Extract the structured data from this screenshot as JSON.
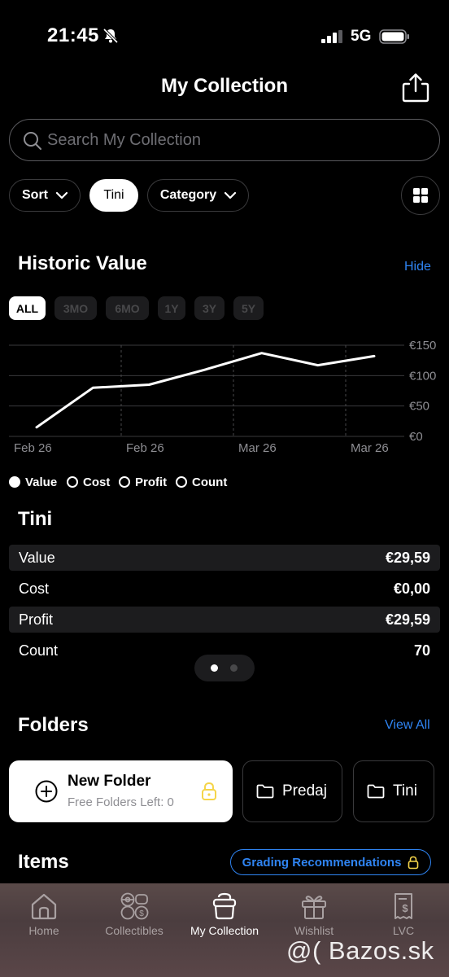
{
  "status_bar": {
    "time": "21:45",
    "network": "5G"
  },
  "header": {
    "title": "My Collection"
  },
  "search": {
    "placeholder": "Search My Collection"
  },
  "filters": {
    "sort_label": "Sort",
    "selected_chip": "Tini",
    "category_label": "Category"
  },
  "historic": {
    "title": "Historic Value",
    "hide_label": "Hide",
    "ranges": [
      "ALL",
      "3MO",
      "6MO",
      "1Y",
      "3Y",
      "5Y"
    ],
    "selected_range": "ALL"
  },
  "chart_data": {
    "type": "line",
    "x_tick_labels": [
      "Feb 26",
      "Feb 26",
      "Mar 26",
      "Mar 26"
    ],
    "y_tick_labels": [
      "€150",
      "€100",
      "€50",
      "€0"
    ],
    "ylim": [
      0,
      150
    ],
    "grid": true,
    "series": [
      {
        "values": [
          15,
          80,
          85,
          110,
          137,
          117,
          132
        ]
      }
    ]
  },
  "legend": {
    "items": [
      "Value",
      "Cost",
      "Profit",
      "Count"
    ],
    "selected": "Value"
  },
  "summary": {
    "title": "Tini",
    "rows": [
      {
        "label": "Value",
        "value": "€29,59"
      },
      {
        "label": "Cost",
        "value": "€0,00"
      },
      {
        "label": "Profit",
        "value": "€29,59"
      },
      {
        "label": "Count",
        "value": "70"
      }
    ]
  },
  "folders": {
    "title": "Folders",
    "view_all_label": "View All",
    "new_folder_label": "New Folder",
    "free_folders_label": "Free Folders Left: 0",
    "items": [
      "Predaj",
      "Tini"
    ]
  },
  "items": {
    "title": "Items",
    "grading_label": "Grading Recommendations"
  },
  "tabbar": {
    "tabs": [
      "Home",
      "Collectibles",
      "My Collection",
      "Wishlist",
      "LVC"
    ],
    "active": "My Collection"
  },
  "watermark": "@( Bazos.sk"
}
